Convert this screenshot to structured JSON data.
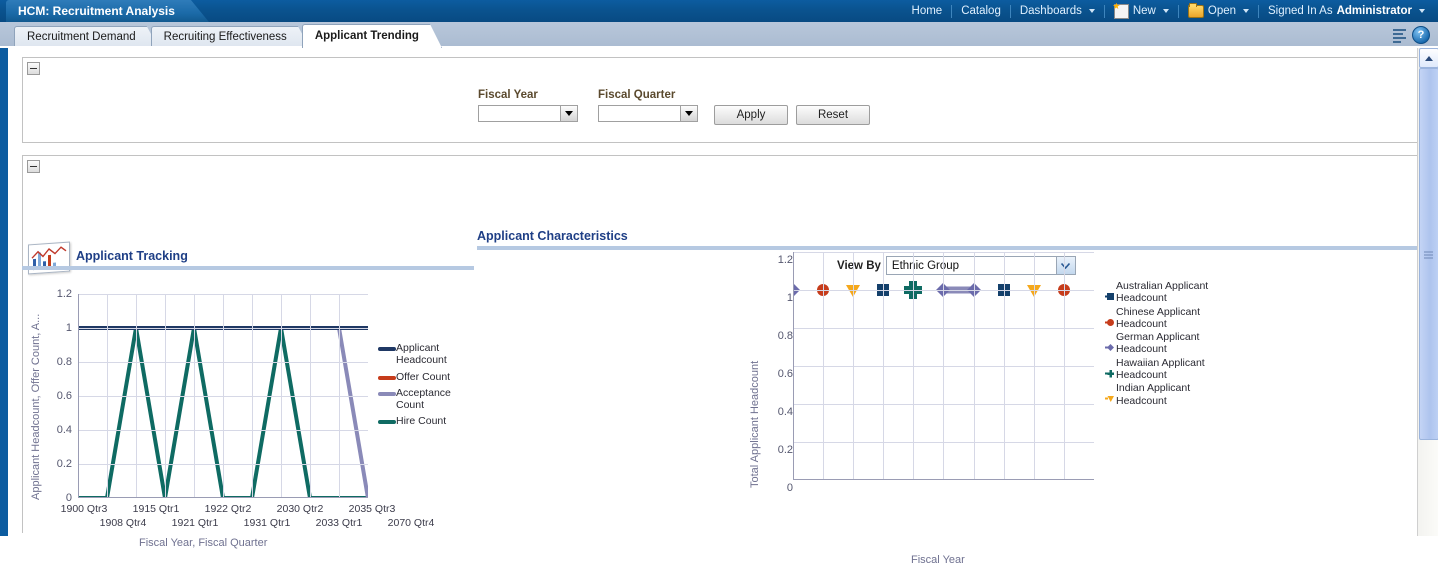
{
  "app": {
    "title": "HCM: Recruitment Analysis"
  },
  "topnav": {
    "home": "Home",
    "catalog": "Catalog",
    "dashboards": "Dashboards",
    "new": "New",
    "open": "Open",
    "signed_in_as": "Signed In As",
    "user": "Administrator"
  },
  "toolbar": {
    "help_glyph": "?"
  },
  "tabs": [
    {
      "label": "Recruitment Demand",
      "active": false
    },
    {
      "label": "Recruiting Effectiveness",
      "active": false
    },
    {
      "label": "Applicant Trending",
      "active": true
    }
  ],
  "prompts": {
    "fiscal_year": {
      "label": "Fiscal Year",
      "value": ""
    },
    "fiscal_quarter": {
      "label": "Fiscal Quarter",
      "value": ""
    },
    "apply_label": "Apply",
    "reset_label": "Reset"
  },
  "left_report": {
    "title": "Applicant Tracking"
  },
  "right_report": {
    "title": "Applicant Characteristics",
    "view_by_label": "View By",
    "view_by_value": "Ethnic Group"
  },
  "colors": {
    "applicant_headcount": "#1f3864",
    "offer_count": "#c63c1b",
    "acceptance_count": "#8a8ab8",
    "hire_count": "#0f6b63",
    "australian": "#1f3864",
    "chinese": "#c63c1b",
    "german": "#6b6bab",
    "hawaiian": "#0f6b63",
    "indian": "#f0a00a",
    "brand_blue": "#0c5ca0",
    "title_blue": "#1f3f86"
  },
  "chart_data": [
    {
      "type": "line",
      "title": "Applicant Tracking",
      "xlabel": "Fiscal Year, Fiscal Quarter",
      "ylabel": "Applicant Headcount, Offer Count, A...",
      "ylim": [
        0.0,
        1.2
      ],
      "yticks": [
        0.0,
        0.2,
        0.4,
        0.6,
        0.8,
        1.0,
        1.2
      ],
      "grid": true,
      "legend_position": "right",
      "categories": [
        "1900 Qtr3",
        "1908 Qtr4",
        "1915 Qtr1",
        "1921 Qtr1",
        "1922 Qtr2",
        "1931 Qtr1",
        "2030 Qtr2",
        "2033 Qtr1",
        "2035 Qtr3",
        "2070 Qtr4"
      ],
      "series": [
        {
          "name": "Applicant Headcount",
          "color": "#1f3864",
          "values": [
            1.0,
            1.0,
            1.0,
            1.0,
            1.0,
            1.0,
            1.0,
            1.0,
            1.0,
            1.0
          ]
        },
        {
          "name": "Offer Count",
          "color": "#c63c1b",
          "values": [
            null,
            null,
            null,
            null,
            null,
            null,
            null,
            null,
            null,
            null
          ]
        },
        {
          "name": "Acceptance Count",
          "color": "#8a8ab8",
          "values": [
            null,
            null,
            null,
            null,
            null,
            null,
            null,
            1.0,
            1.0,
            0.0
          ]
        },
        {
          "name": "Hire Count",
          "color": "#0f6b63",
          "values": [
            0.0,
            0.0,
            1.0,
            0.0,
            1.0,
            0.0,
            0.0,
            1.0,
            0.0,
            0.0
          ]
        }
      ]
    },
    {
      "type": "scatter",
      "title": "Applicant Characteristics",
      "xlabel": "Fiscal Year",
      "ylabel": "Total Applicant Headcount",
      "ylim": [
        0.0,
        1.2
      ],
      "yticks": [
        0.0,
        0.2,
        0.4,
        0.6,
        0.8,
        1.0,
        1.2
      ],
      "xticks": [],
      "grid": true,
      "legend_position": "right",
      "series": [
        {
          "name": "Australian Applicant Headcount",
          "color": "#1f3864",
          "marker": "square",
          "x": [
            3,
            7
          ],
          "y": [
            1.0,
            1.0
          ]
        },
        {
          "name": "Chinese Applicant Headcount",
          "color": "#c63c1b",
          "marker": "circle",
          "x": [
            1,
            9
          ],
          "y": [
            1.0,
            1.0
          ]
        },
        {
          "name": "German Applicant Headcount",
          "color": "#6b6bab",
          "marker": "diamond",
          "x": [
            0,
            5,
            6
          ],
          "y": [
            1.0,
            1.0,
            1.0
          ]
        },
        {
          "name": "Hawaiian Applicant Headcount",
          "color": "#0f6b63",
          "marker": "plus",
          "x": [
            4
          ],
          "y": [
            1.0
          ]
        },
        {
          "name": "Indian Applicant Headcount",
          "color": "#f0a00a",
          "marker": "triangle-down",
          "x": [
            2,
            8
          ],
          "y": [
            1.0,
            1.0
          ]
        }
      ]
    }
  ]
}
